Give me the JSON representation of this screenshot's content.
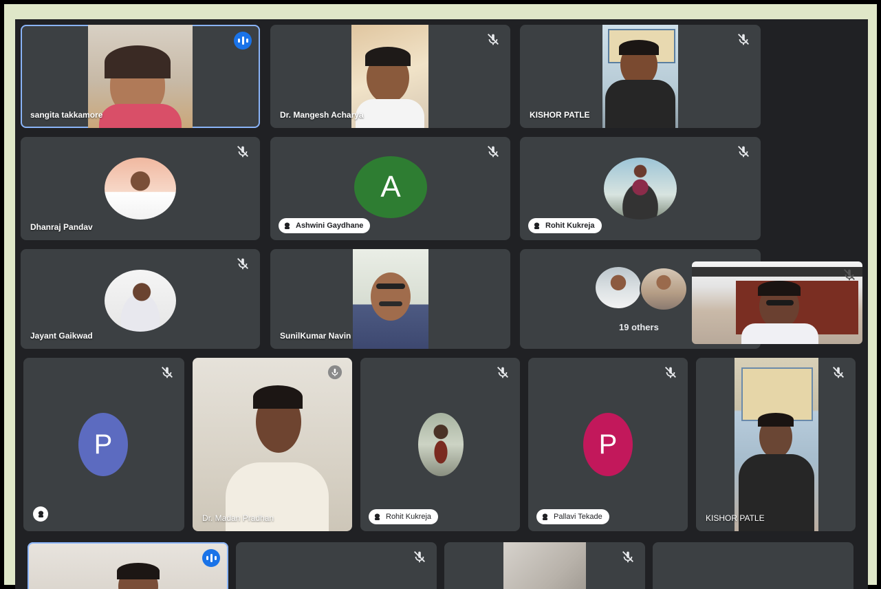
{
  "meeting": {
    "row1": [
      {
        "name": "sangita takkamore",
        "speaking": true
      },
      {
        "name": "Dr. Mangesh Acharya",
        "muted": true
      },
      {
        "name": "KISHOR PATLE",
        "muted": true
      }
    ],
    "row2": [
      {
        "name": "Dhanraj Pandav",
        "muted": true
      },
      {
        "name": "Ashwini Gaydhane",
        "avatar_letter": "A",
        "avatar_color": "#2e7d32",
        "muted": true
      },
      {
        "name": "Rohit Kukreja",
        "muted": true
      }
    ],
    "row3": [
      {
        "name": "Jayant Gaikwad",
        "muted": true
      },
      {
        "name": "SunilKumar Navin",
        "muted": true
      },
      {
        "others_label": "19 others"
      }
    ],
    "row4": [
      {
        "avatar_letter": "P",
        "avatar_color": "#5c6bc0",
        "muted": true
      },
      {
        "name": "Dr. Madan Pradhan",
        "muted": true
      },
      {
        "name": "Rohit Kukreja",
        "muted": true
      },
      {
        "name": "Pallavi Tekade",
        "avatar_letter": "P",
        "avatar_color": "#c2185b",
        "muted": true
      },
      {
        "name": "KISHOR PATLE",
        "muted": true
      }
    ]
  },
  "colors": {
    "tile_bg": "#3c4043",
    "speaking_blue": "#1a73e8",
    "active_border": "#8ab4f8"
  },
  "icons": [
    "mic-off-icon",
    "audio-level-icon",
    "pin-icon"
  ]
}
